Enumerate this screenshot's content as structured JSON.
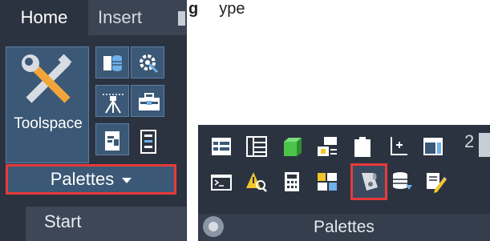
{
  "left_panel": {
    "tabs": {
      "home": "Home",
      "insert": "Insert"
    },
    "big_button": {
      "label": "Toolspace",
      "icon": "wrench-screwdriver-icon"
    },
    "small_icons": [
      "data-store-icon",
      "gear-settings-icon",
      "survey-tripod-icon",
      "toolbox-icon",
      "document-panel-icon",
      "property-list-icon"
    ],
    "panel_title": "Palettes",
    "start_tab": "Start"
  },
  "fragment_text": {
    "bold": "g",
    "rest": "ype"
  },
  "right_panel": {
    "row1_icons": [
      "tool-palette-icon",
      "properties-grid-icon",
      "green-cube-icon",
      "layer-manager-icon",
      "clipboard-icon",
      "ucs-axis-icon",
      "ribbon-window-icon"
    ],
    "row1_number": "2",
    "row2_icons": [
      "command-line-icon",
      "warning-search-icon",
      "calculator-icon",
      "design-center-icon",
      "toolspace-scroll-icon",
      "database-connect-icon",
      "markup-pencil-icon"
    ],
    "panel_title": "Palettes"
  }
}
